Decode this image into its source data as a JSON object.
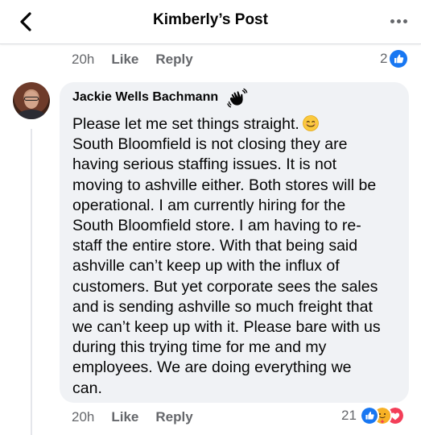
{
  "header": {
    "title": "Kimberly’s Post"
  },
  "previous_comment": {
    "time": "20h",
    "like_label": "Like",
    "reply_label": "Reply",
    "reaction_count": "2"
  },
  "comment": {
    "author": "Jackie Wells Bachmann",
    "lines": [
      "Please let me set things straight.",
      "South Bloomfield is not closing they are",
      "having serious staffing issues. It is not",
      "moving to ashville either. Both stores will be",
      "operational. I am currently hiring for the",
      "South Bloomfield store. I am having to re-",
      "staff the entire store. With that being said",
      "ashville can’t keep up with the influx of",
      "customers. But yet corporate sees the sales",
      "and is sending ashville so much freight that",
      "we can’t keep up with it. Please bare with us",
      "during this trying time for me and my",
      "employees. We are doing everything we",
      "can."
    ],
    "time": "20h",
    "like_label": "Like",
    "reply_label": "Reply",
    "reaction_count": "21"
  },
  "colors": {
    "accent": "#1877f2",
    "muted": "#65676b",
    "bubble": "#f0f2f5",
    "love": "#f33e58",
    "care": "#f7b125"
  },
  "icons": {
    "back": "chevron-left-icon",
    "more": "more-horizontal-icon",
    "badge": "waving-hand-badge-icon",
    "like_reaction": "like-reaction-icon",
    "care_reaction": "care-reaction-icon",
    "love_reaction": "love-reaction-icon",
    "emoji": "smiling-face-emoji"
  }
}
